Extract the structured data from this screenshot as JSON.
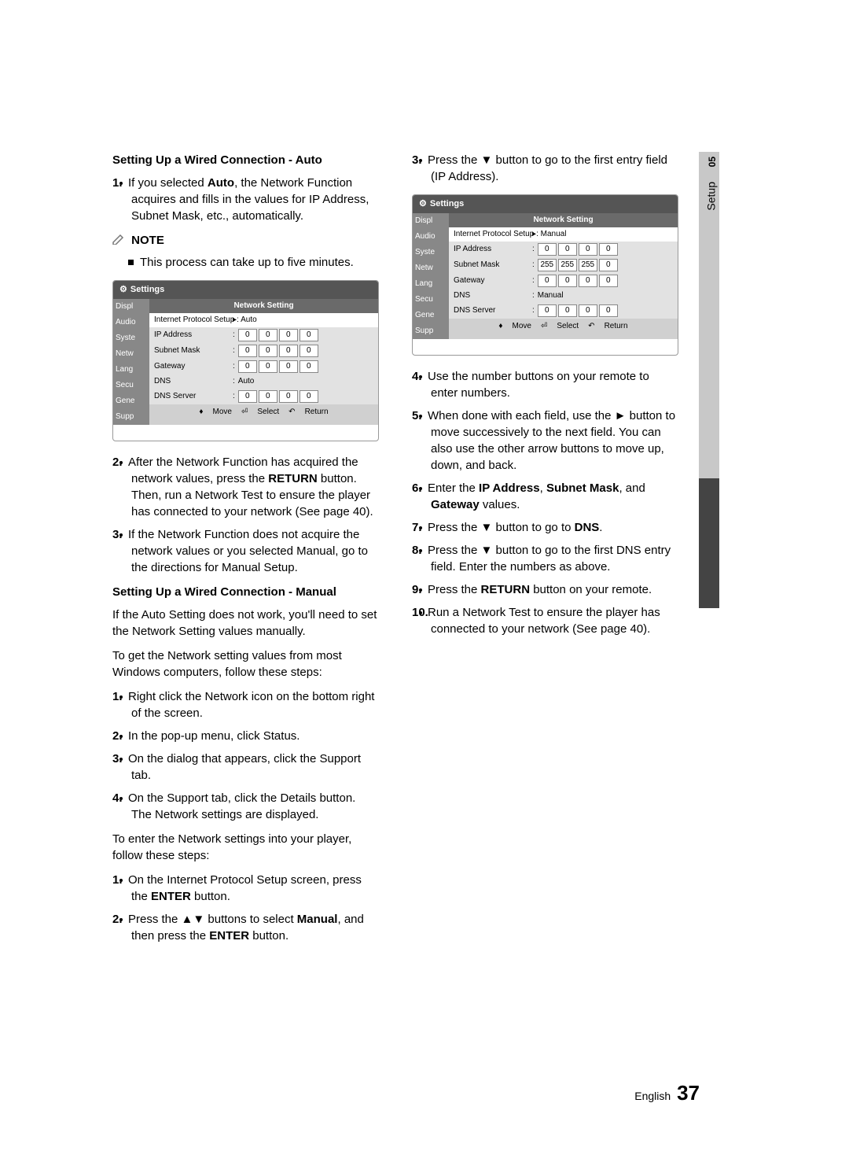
{
  "sideTab": {
    "num": "05",
    "label": "Setup"
  },
  "left": {
    "h1": "Setting Up a Wired Connection - Auto",
    "step1": {
      "num": "1.",
      "pre": "If you selected ",
      "b": "Auto",
      "post": ", the Network Function acquires and fills in the values for IP Address, Subnet Mask, etc., automatically."
    },
    "noteHead": "NOTE",
    "noteBody": "This process can take up to five minutes.",
    "panel": {
      "title": "Settings",
      "header": "Network Setting",
      "side": [
        "Displ",
        "Audio",
        "Syste",
        "Netw",
        "Lang",
        "Secu",
        "Gene",
        "Supp"
      ],
      "rows": {
        "ips": {
          "label": "Internet Protocol Setup",
          "val": "Auto"
        },
        "ip": {
          "label": "IP Address",
          "o": [
            "0",
            "0",
            "0",
            "0"
          ]
        },
        "sm": {
          "label": "Subnet Mask",
          "o": [
            "0",
            "0",
            "0",
            "0"
          ]
        },
        "gw": {
          "label": "Gateway",
          "o": [
            "0",
            "0",
            "0",
            "0"
          ]
        },
        "dns": {
          "label": "DNS",
          "val": "Auto"
        },
        "dsv": {
          "label": "DNS Server",
          "o": [
            "0",
            "0",
            "0",
            "0"
          ]
        }
      },
      "foot": {
        "move": "Move",
        "select": "Select",
        "return": "Return"
      }
    },
    "step2": {
      "num": "2.",
      "text": "After the Network Function has acquired the network values, press the ",
      "b": "RETURN",
      "post": " button. Then, run a Network Test to ensure the player has connected to your network (See page 40)."
    },
    "step3": {
      "num": "3.",
      "text": "If the Network Function does not acquire the network values or you selected Manual, go to the directions for Manual Setup."
    },
    "h2": "Setting Up a Wired Connection - Manual",
    "p1": "If the Auto Setting does not work, you'll need to set the Network Setting values manually.",
    "p2": "To get the Network setting values from most Windows computers, follow these steps:",
    "m1": {
      "num": "1.",
      "text": "Right click the Network icon on the bottom right of the screen."
    },
    "m2": {
      "num": "2.",
      "text": "In the pop-up menu, click Status."
    },
    "m3": {
      "num": "3.",
      "text": "On the dialog that appears, click the Support tab."
    },
    "m4": {
      "num": "4.",
      "text": "On the Support tab, click the Details button. The Network settings are displayed."
    },
    "p3": "To enter the Network settings into your player, follow these steps:",
    "e1": {
      "num": "1.",
      "pre": "On the Internet Protocol Setup screen, press the ",
      "b": "ENTER",
      "post": " button."
    },
    "e2": {
      "num": "2.",
      "pre": "Press the ▲▼ buttons to select ",
      "b": "Manual",
      "post": ", and then press the ",
      "b2": "ENTER",
      "post2": " button."
    }
  },
  "right": {
    "r3": {
      "num": "3.",
      "text": "Press the ▼ button to go to the first entry field (IP Address)."
    },
    "panel": {
      "title": "Settings",
      "header": "Network Setting",
      "side": [
        "Displ",
        "Audio",
        "Syste",
        "Netw",
        "Lang",
        "Secu",
        "Gene",
        "Supp"
      ],
      "rows": {
        "ips": {
          "label": "Internet Protocol Setup",
          "val": "Manual"
        },
        "ip": {
          "label": "IP Address",
          "o": [
            "0",
            "0",
            "0",
            "0"
          ]
        },
        "sm": {
          "label": "Subnet Mask",
          "o": [
            "255",
            "255",
            "255",
            "0"
          ]
        },
        "gw": {
          "label": "Gateway",
          "o": [
            "0",
            "0",
            "0",
            "0"
          ]
        },
        "dns": {
          "label": "DNS",
          "val": "Manual"
        },
        "dsv": {
          "label": "DNS Server",
          "o": [
            "0",
            "0",
            "0",
            "0"
          ]
        }
      },
      "foot": {
        "move": "Move",
        "select": "Select",
        "return": "Return"
      }
    },
    "r4": {
      "num": "4.",
      "text": "Use the number buttons on your remote to enter numbers."
    },
    "r5": {
      "num": "5.",
      "text": "When done with each field, use the ► button to move successively to the next field. You can also use the other arrow buttons to move up, down, and back."
    },
    "r6": {
      "num": "6.",
      "pre": "Enter the ",
      "b1": "IP Address",
      "mid": ", ",
      "b2": "Subnet Mask",
      "mid2": ", and ",
      "b3": "Gateway",
      "post": " values."
    },
    "r7": {
      "num": "7.",
      "pre": "Press the ▼ button to go to ",
      "b": "DNS",
      "post": "."
    },
    "r8": {
      "num": "8.",
      "text": "Press the ▼ button to go to the first DNS entry field. Enter the numbers as above."
    },
    "r9": {
      "num": "9.",
      "pre": "Press the ",
      "b": "RETURN",
      "post": " button on your remote."
    },
    "r10": {
      "num": "10.",
      "text": "Run a Network Test to ensure the player has connected to your network (See page 40)."
    }
  },
  "footer": {
    "lang": "English",
    "page": "37"
  }
}
